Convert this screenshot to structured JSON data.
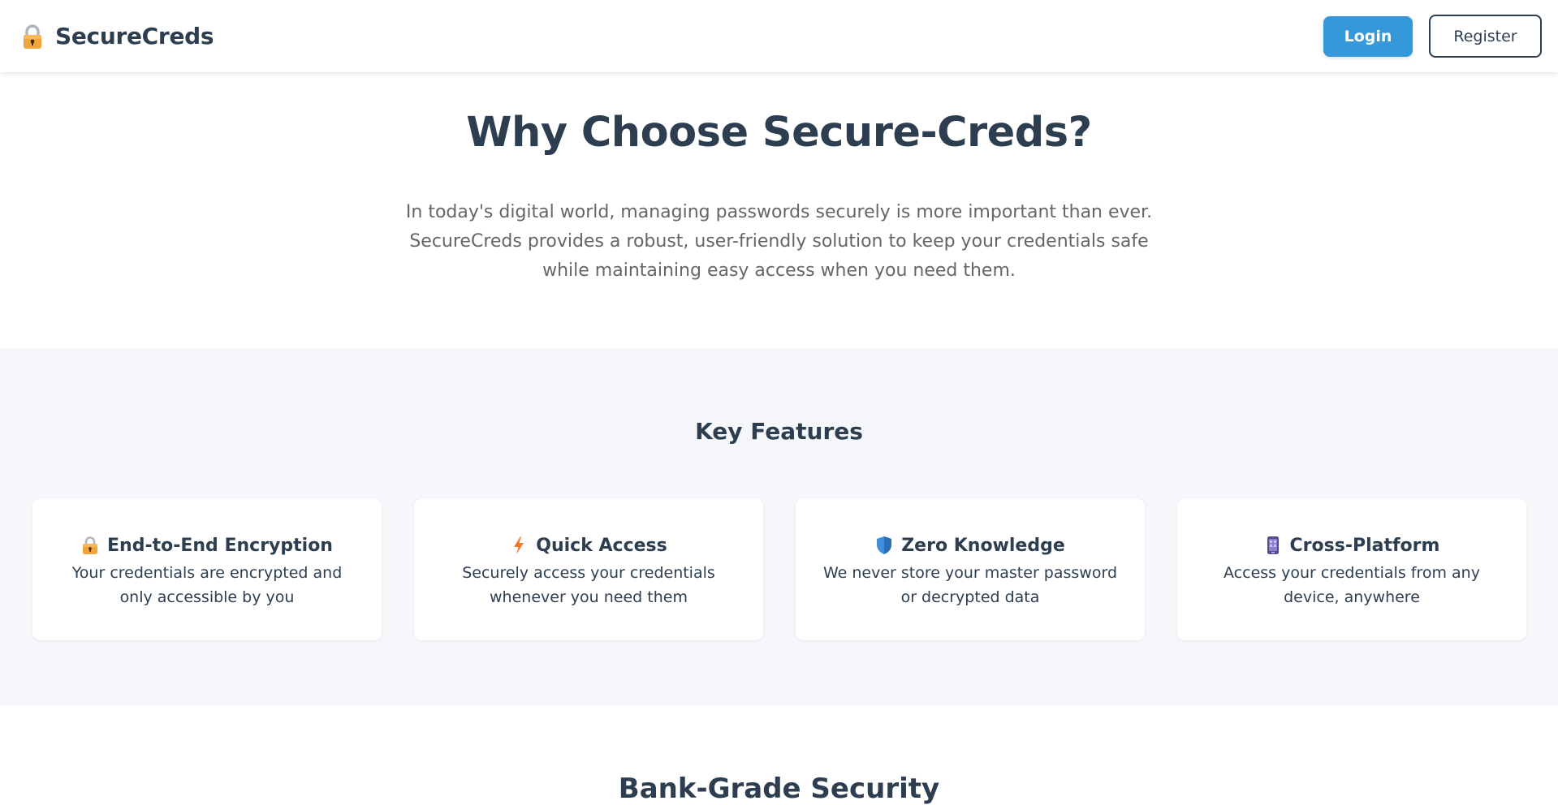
{
  "header": {
    "brand_name": "SecureCreds",
    "brand_icon": "lock-icon",
    "login_label": "Login",
    "register_label": "Register"
  },
  "hero": {
    "title": "Why Choose Secure-Creds?",
    "description": "In today's digital world, managing passwords securely is more important than ever. SecureCreds provides a robust, user-friendly solution to keep your credentials safe while maintaining easy access when you need them."
  },
  "features": {
    "heading": "Key Features",
    "items": [
      {
        "icon": "lock-icon",
        "title": "End-to-End Encryption",
        "description": "Your credentials are encrypted and only accessible by you"
      },
      {
        "icon": "lightning-icon",
        "title": "Quick Access",
        "description": "Securely access your credentials whenever you need them"
      },
      {
        "icon": "shield-icon",
        "title": "Zero Knowledge",
        "description": "We never store your master password or decrypted data"
      },
      {
        "icon": "mobile-phone-icon",
        "title": "Cross-Platform",
        "description": "Access your credentials from any device, anywhere"
      }
    ]
  },
  "next_section": {
    "title": "Bank-Grade Security"
  },
  "colors": {
    "primary": "#3498db",
    "text_dark": "#2c3e50",
    "text_muted": "#666666",
    "section_bg": "#f5f7fa"
  }
}
